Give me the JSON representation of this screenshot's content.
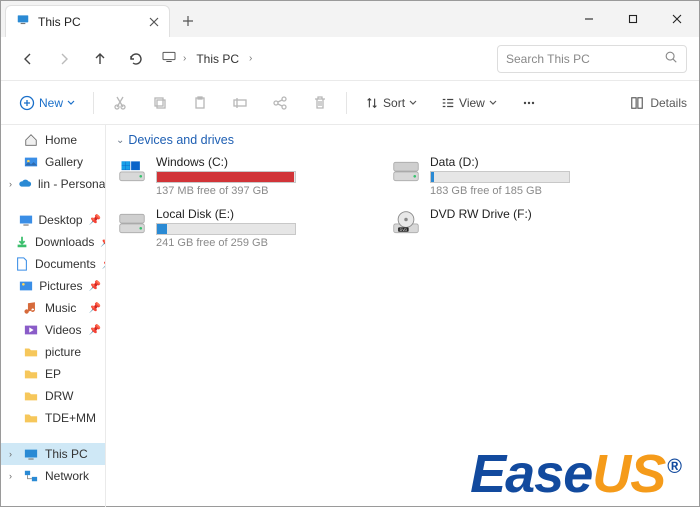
{
  "tab": {
    "title": "This PC"
  },
  "breadcrumb": {
    "label": "This PC"
  },
  "search": {
    "placeholder": "Search This PC"
  },
  "toolbar": {
    "new": "New",
    "sort": "Sort",
    "view": "View",
    "details": "Details"
  },
  "sidebar": {
    "home": "Home",
    "gallery": "Gallery",
    "personal": "lin - Personal",
    "desktop": "Desktop",
    "downloads": "Downloads",
    "documents": "Documents",
    "pictures": "Pictures",
    "music": "Music",
    "videos": "Videos",
    "picture": "picture",
    "ep": "EP",
    "drw": "DRW",
    "tdemm": "TDE+MM",
    "thispc": "This PC",
    "network": "Network"
  },
  "group_header": "Devices and drives",
  "drives": [
    {
      "name": "Windows (C:)",
      "meta": "137 MB free of 397 GB",
      "fill_percent": 99,
      "fill_color": "#d13438",
      "type": "os"
    },
    {
      "name": "Data (D:)",
      "meta": "183 GB free of 185 GB",
      "fill_percent": 2,
      "fill_color": "#2a8ad4",
      "type": "hdd"
    },
    {
      "name": "Local Disk (E:)",
      "meta": "241 GB free of 259 GB",
      "fill_percent": 7,
      "fill_color": "#2a8ad4",
      "type": "hdd"
    },
    {
      "name": "DVD RW Drive (F:)",
      "meta": "",
      "fill_percent": null,
      "fill_color": "",
      "type": "dvd"
    }
  ],
  "watermark": {
    "ease": "Ease",
    "us": "US",
    "reg": "®"
  }
}
